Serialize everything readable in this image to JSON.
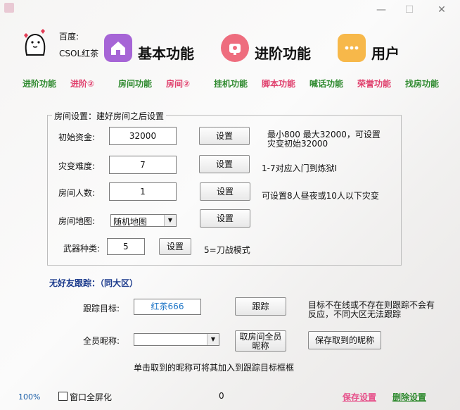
{
  "window": {
    "minimize": "—",
    "maximize": "☐",
    "close": "✕"
  },
  "account": {
    "line1": "百度:",
    "line2": "CSOL红茶"
  },
  "header_tabs": [
    {
      "label": "基本功能",
      "color": "#a665d6"
    },
    {
      "label": "进阶功能",
      "color": "#ee6d7e"
    },
    {
      "label": "用户",
      "color": "#f7b84a"
    }
  ],
  "nav": [
    {
      "label": "进阶功能",
      "color": "#2f8a2f"
    },
    {
      "label": "进阶②",
      "color": "#e0406d"
    },
    {
      "label": "房间功能",
      "color": "#2f8a2f"
    },
    {
      "label": "房间②",
      "color": "#e0406d"
    },
    {
      "label": "挂机功能",
      "color": "#2f8a2f"
    },
    {
      "label": "脚本功能",
      "color": "#e0406d"
    },
    {
      "label": "喊话功能",
      "color": "#2f8a2f"
    },
    {
      "label": "荣誉功能",
      "color": "#e0406d"
    },
    {
      "label": "找房功能",
      "color": "#2f8a2f"
    }
  ],
  "room": {
    "title": "房间设置：建好房间之后设置",
    "set_label": "设置",
    "funds": {
      "label": "初始资金:",
      "value": "32000",
      "note1": "最小800 最大32000，可设置",
      "note2": "灾变初始32000"
    },
    "difficulty": {
      "label": "灾变难度:",
      "value": "7",
      "note": "1-7对应入门到炼狱I"
    },
    "players": {
      "label": "房间人数:",
      "value": "1",
      "note": "可设置8人昼夜或10人以下灾变"
    },
    "map": {
      "label": "房间地图:",
      "value": "随机地图"
    },
    "weapon": {
      "label": "武器种类:",
      "value": "5",
      "note": "5=刀战模式"
    }
  },
  "track": {
    "title": "无好友跟踪：（同大区）",
    "target_label": "跟踪目标:",
    "target_value": "红茶666",
    "track_button": "跟踪",
    "note1": "目标不在线或不存在则跟踪不会有",
    "note2": "反应，不同大区无法跟踪",
    "nick_label": "全员昵称:",
    "nick_value": "",
    "fetch_button_l1": "取房间全员",
    "fetch_button_l2": "昵称",
    "save_nick_button": "保存取到的昵称",
    "hint": "单击取到的昵称可将其加入到跟踪目标框框"
  },
  "footer": {
    "zoom": "100%",
    "fullscreen_label": "窗口全屏化",
    "counter": "0",
    "save": "保存设置",
    "delete": "删除设置"
  }
}
